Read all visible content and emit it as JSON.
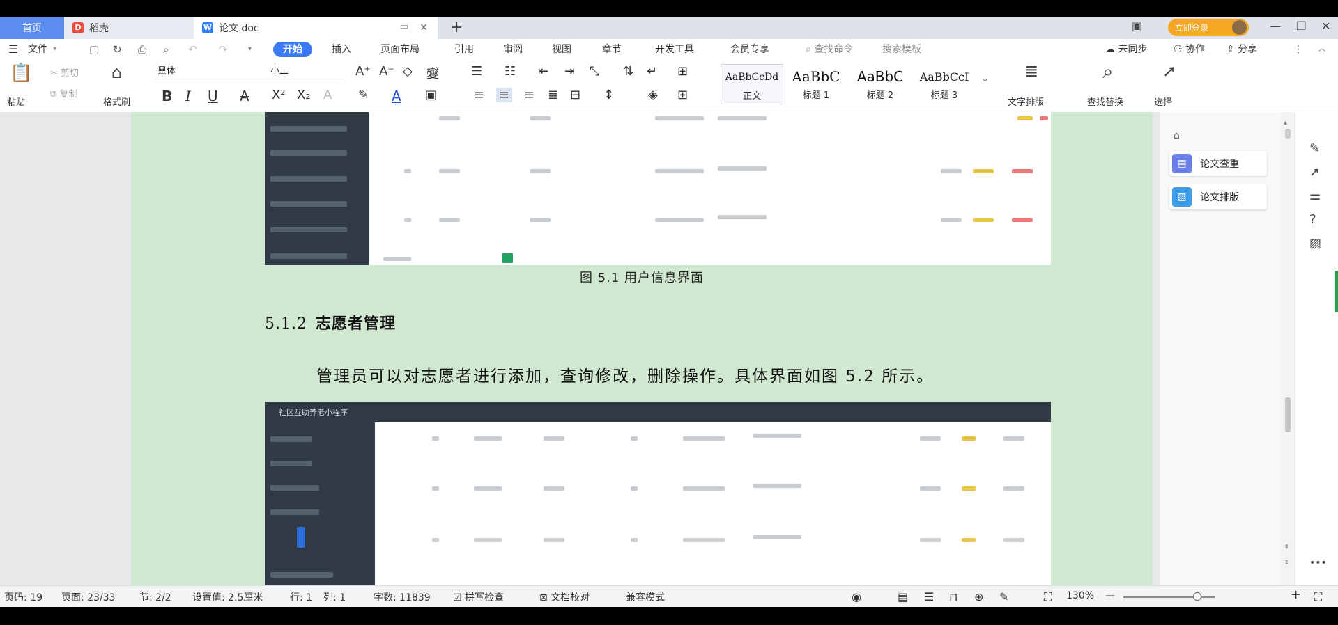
{
  "tabs": {
    "home": "首页",
    "t2": "稻壳",
    "t3": "论文.doc",
    "vip_label": "立即登录"
  },
  "menu": {
    "file": "文件",
    "items": [
      "开始",
      "插入",
      "页面布局",
      "引用",
      "审阅",
      "视图",
      "章节",
      "开发工具",
      "会员专享"
    ],
    "search_cmd": "查找命令",
    "search_tpl": "搜索模板",
    "sync": "未同步",
    "collab": "协作",
    "share": "分享"
  },
  "toolbar": {
    "paste": "粘贴",
    "cut": "剪切",
    "copy": "复制",
    "format_painter": "格式刷",
    "font_name": "黑体",
    "font_size": "小二",
    "styles": [
      {
        "sample": "AaBbCcDd",
        "name": "正文"
      },
      {
        "sample": "AaBbC",
        "name": "标题 1"
      },
      {
        "sample": "AaBbC",
        "name": "标题 2"
      },
      {
        "sample": "AaBbCcI",
        "name": "标题 3"
      }
    ],
    "text_layout": "文字排版",
    "find_replace": "查找替换",
    "select": "选择"
  },
  "doc": {
    "caption1": "图 5.1  用户信息界面",
    "heading_num": "5.1.2",
    "heading_text": "志愿者管理",
    "para": "管理员可以对志愿者进行添加，查询修改，删除操作。具体界面如图 5.2 所示。",
    "shot2_title": "社区互助养老小程序"
  },
  "sidepanel": {
    "btn1": "论文查重",
    "btn2": "论文排版"
  },
  "status": {
    "page_code": "页码: 19",
    "page": "页面: 23/33",
    "section": "节: 2/2",
    "setting": "设置值: 2.5厘米",
    "row": "行: 1",
    "col": "列: 1",
    "words": "字数: 11839",
    "spell": "拼写检查",
    "proof": "文档校对",
    "compat": "兼容模式",
    "zoom": "130%",
    "zoom_level": 0.8
  },
  "colors": {
    "accent": "#3c7af5",
    "page_bg": "#cfe8cf",
    "dark_sidebar": "#2f3a45"
  }
}
